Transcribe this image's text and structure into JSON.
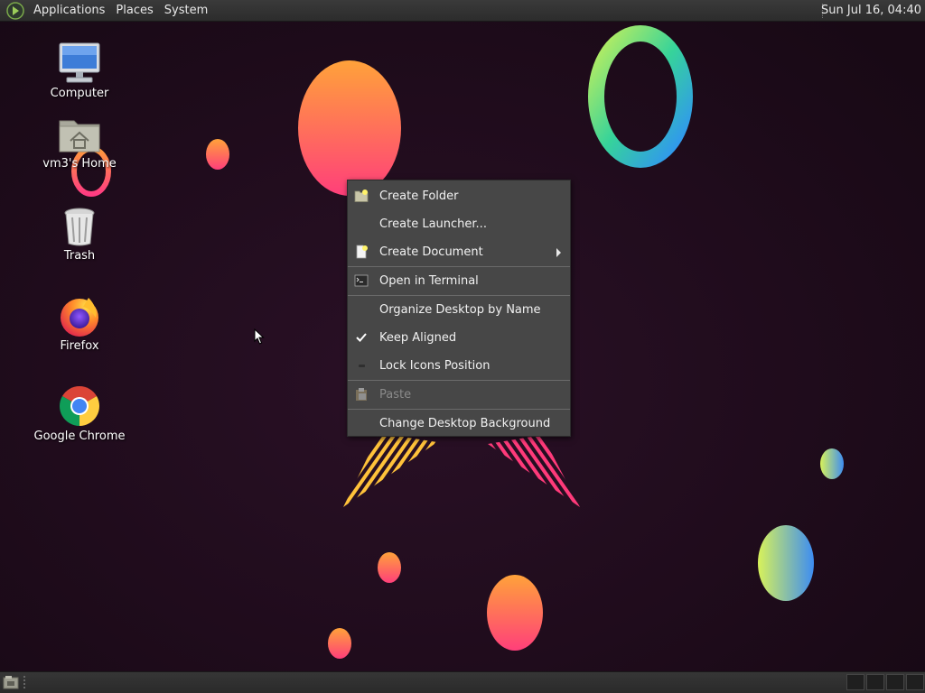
{
  "top_panel": {
    "menus": [
      "Applications",
      "Places",
      "System"
    ],
    "clock": "Sun Jul 16, 04:40"
  },
  "desktop_icons": [
    {
      "label": "Computer",
      "icon": "computer-icon"
    },
    {
      "label": "vm3's Home",
      "icon": "home-folder-icon"
    },
    {
      "label": "Trash",
      "icon": "trash-icon"
    },
    {
      "label": "Firefox",
      "icon": "firefox-icon"
    },
    {
      "label": "Google Chrome",
      "icon": "chrome-icon"
    }
  ],
  "context_menu": {
    "items": [
      {
        "label": "Create Folder",
        "icon": "folder-new-icon"
      },
      {
        "label": "Create Launcher...",
        "icon": ""
      },
      {
        "label": "Create Document",
        "icon": "document-new-icon",
        "submenu": true
      },
      {
        "label": "Open in Terminal",
        "icon": "terminal-icon"
      },
      {
        "label": "Organize Desktop by Name",
        "icon": ""
      },
      {
        "label": "Keep Aligned",
        "icon": "check-icon",
        "checked": true
      },
      {
        "label": "Lock Icons Position",
        "icon": "unchecked-icon",
        "checked": false
      },
      {
        "label": "Paste",
        "icon": "paste-icon",
        "disabled": true
      },
      {
        "label": "Change Desktop Background",
        "icon": ""
      }
    ]
  },
  "colors": {
    "desktop_background": "#1f0c1c",
    "menu_background": "#474747",
    "panel_background": "#2e2e2e"
  }
}
